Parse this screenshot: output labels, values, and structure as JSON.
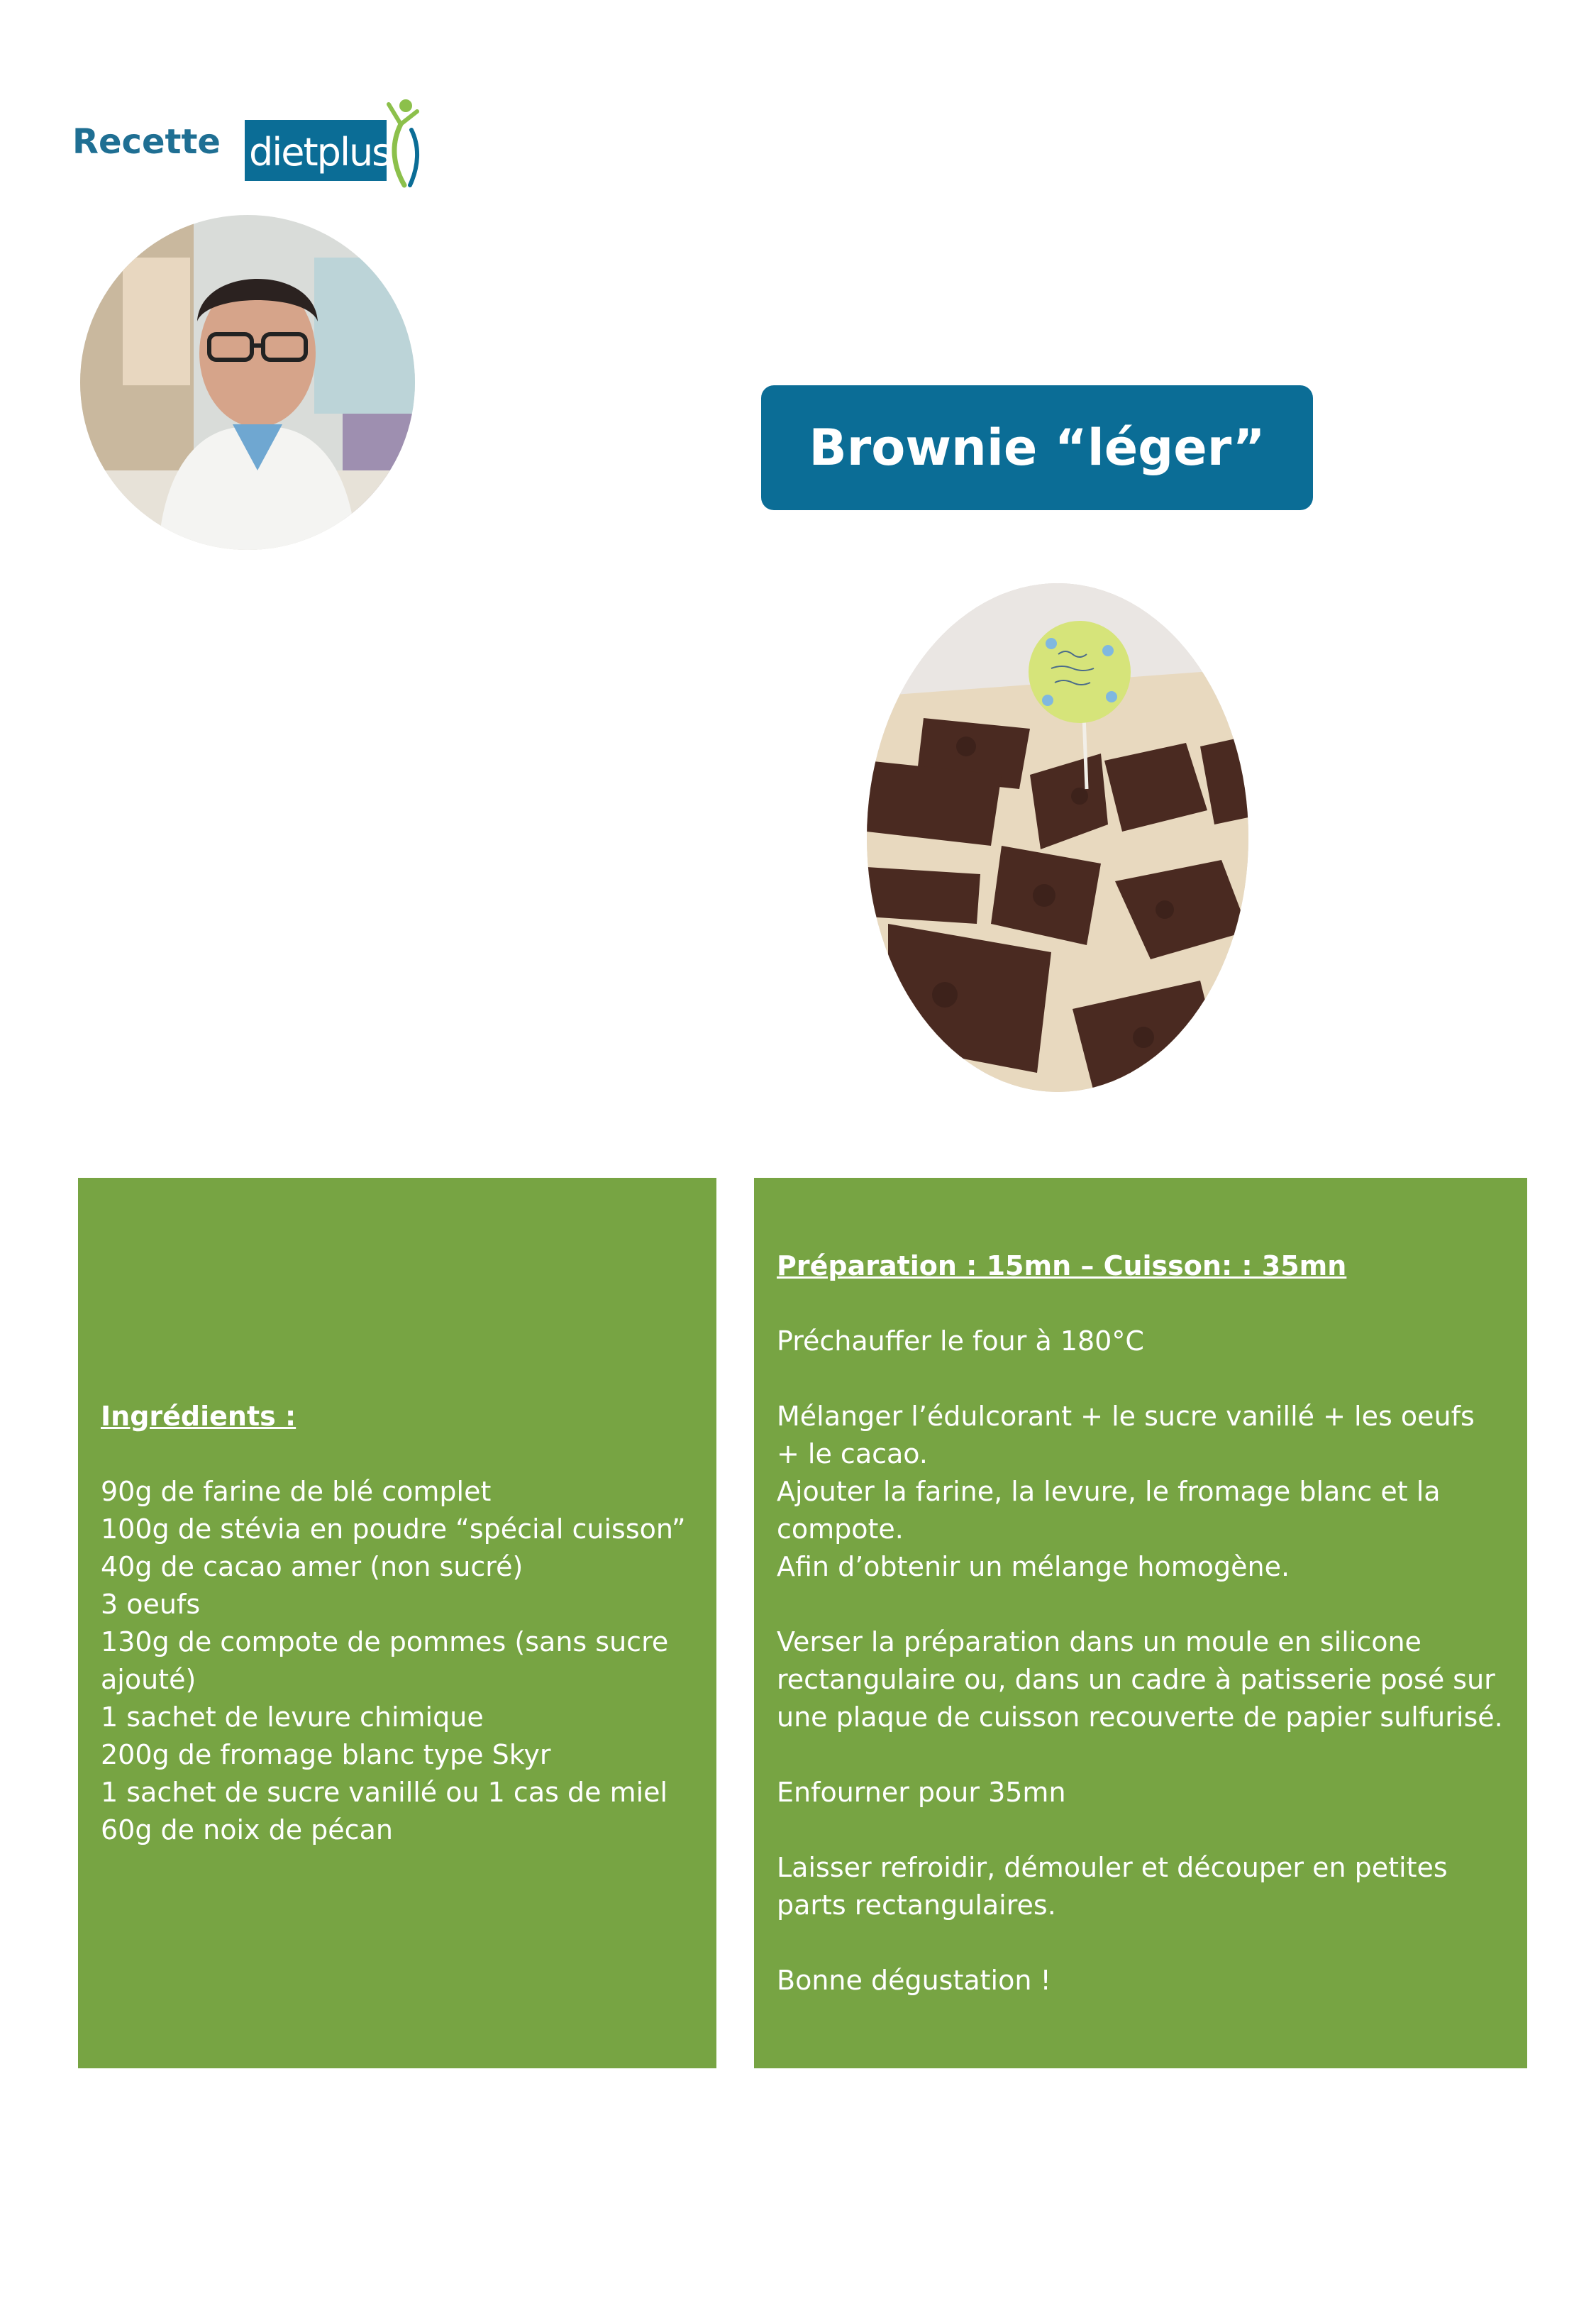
{
  "header": {
    "label": "Recette",
    "logo_text": "dietplus"
  },
  "colors": {
    "brand_blue": "#0b6d96",
    "panel_green": "#77a443",
    "figure_green": "#8cc04b"
  },
  "title": "Brownie “léger”",
  "ingredients": {
    "heading": "Ingrédients :",
    "items": [
      "90g de farine de blé complet",
      "100g de stévia en poudre “spécial cuisson”",
      "40g de cacao amer (non sucré)",
      "3 oeufs",
      "130g de compote de pommes (sans sucre ajouté)",
      "1 sachet de levure chimique",
      "200g de fromage blanc type Skyr",
      "1 sachet de sucre vanillé ou 1 cas de miel",
      "60g de noix de pécan"
    ]
  },
  "preparation": {
    "heading": "Préparation : 15mn – Cuisson: : 35mn",
    "paragraphs": [
      "Préchauffer le four à 180°C",
      "Mélanger l’édulcorant + le sucre vanillé + les oeufs + le cacao.",
      "Ajouter la farine, la levure, le fromage blanc et la compote.",
      "Afin d’obtenir un mélange homogène.",
      "Verser la préparation dans un moule en silicone rectangulaire ou, dans un cadre à patisserie posé sur une plaque de cuisson recouverte de papier sulfurisé.",
      "Enfourner pour 35mn",
      "Laisser refroidir, démouler et découper en petites parts rectangulaires.",
      "Bonne dégustation !"
    ]
  }
}
